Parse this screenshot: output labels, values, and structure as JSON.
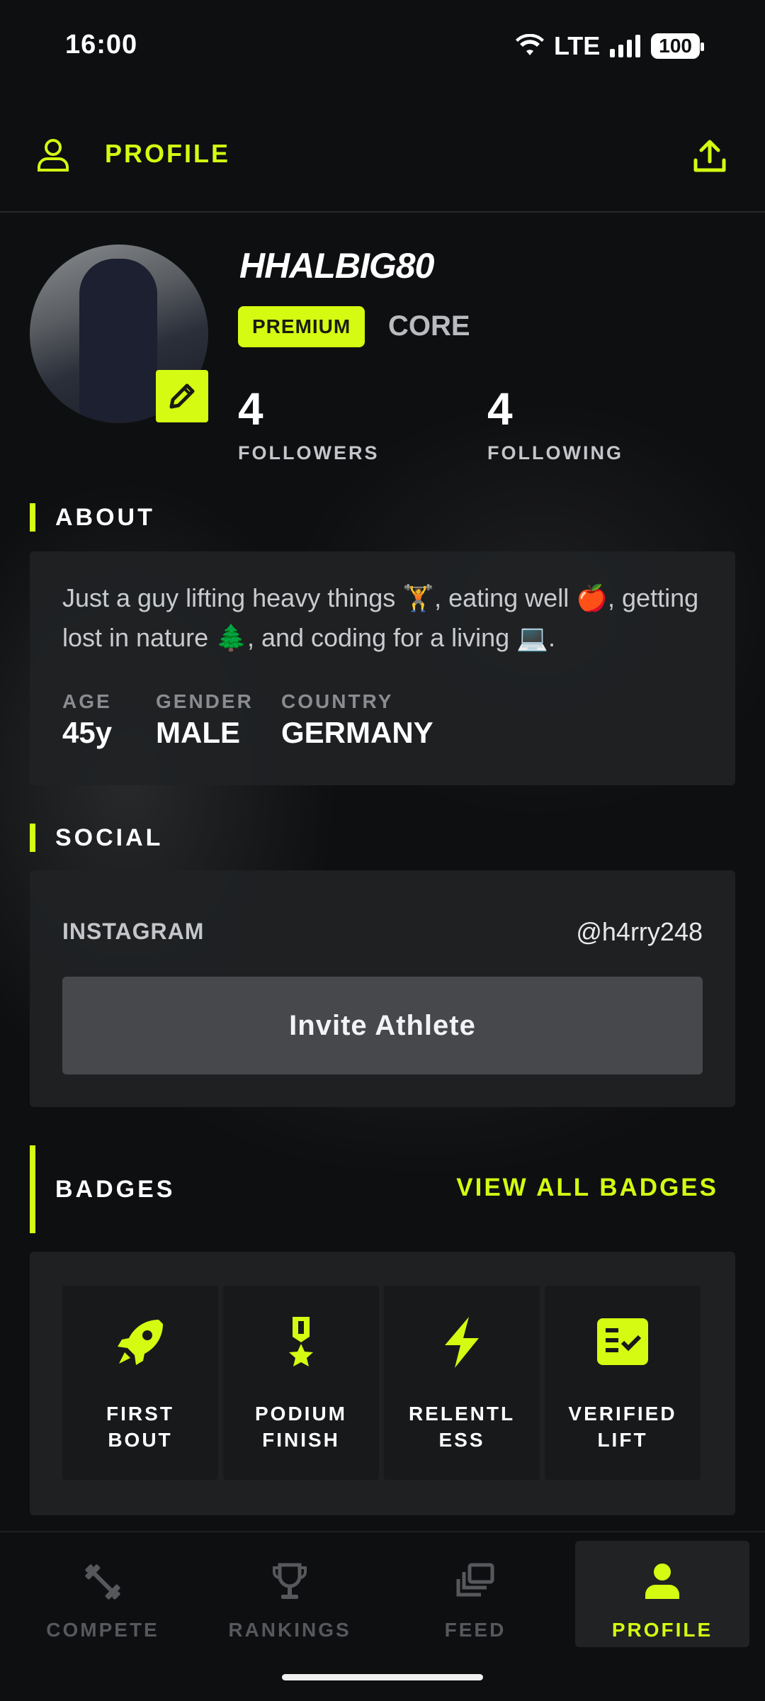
{
  "status": {
    "time": "16:00",
    "network": "LTE",
    "battery": "100"
  },
  "header": {
    "title": "PROFILE"
  },
  "profile": {
    "username": "HHALBIG80",
    "plan": "PREMIUM",
    "tier": "CORE",
    "followers": {
      "count": "4",
      "label": "FOLLOWERS"
    },
    "following": {
      "count": "4",
      "label": "FOLLOWING"
    }
  },
  "about": {
    "title": "ABOUT",
    "bio": "Just a guy lifting heavy things 🏋️, eating well 🍎, getting lost in nature 🌲, and coding for a living 💻.",
    "fields": [
      {
        "label": "AGE",
        "value": "45y"
      },
      {
        "label": "GENDER",
        "value": "MALE"
      },
      {
        "label": "COUNTRY",
        "value": "GERMANY"
      }
    ]
  },
  "social": {
    "title": "SOCIAL",
    "instagram_label": "INSTAGRAM",
    "instagram_handle": "@h4rry248",
    "invite_label": "Invite Athlete"
  },
  "badges": {
    "title": "BADGES",
    "view_all": "VIEW ALL BADGES",
    "items": [
      {
        "label": "FIRST\nBOUT",
        "icon": "rocket-icon"
      },
      {
        "label": "PODIUM\nFINISH",
        "icon": "medal-icon"
      },
      {
        "label": "RELENTL\nESS",
        "icon": "lightning-icon"
      },
      {
        "label": "VERIFIED\nLIFT",
        "icon": "verified-list-icon"
      }
    ]
  },
  "nav": {
    "items": [
      {
        "label": "COMPETE",
        "icon": "dumbbell-icon"
      },
      {
        "label": "RANKINGS",
        "icon": "trophy-icon"
      },
      {
        "label": "FEED",
        "icon": "feed-icon"
      },
      {
        "label": "PROFILE",
        "icon": "person-icon"
      }
    ]
  },
  "colors": {
    "accent": "#d4fb11",
    "background": "#0e0f11",
    "card": "#202224"
  }
}
